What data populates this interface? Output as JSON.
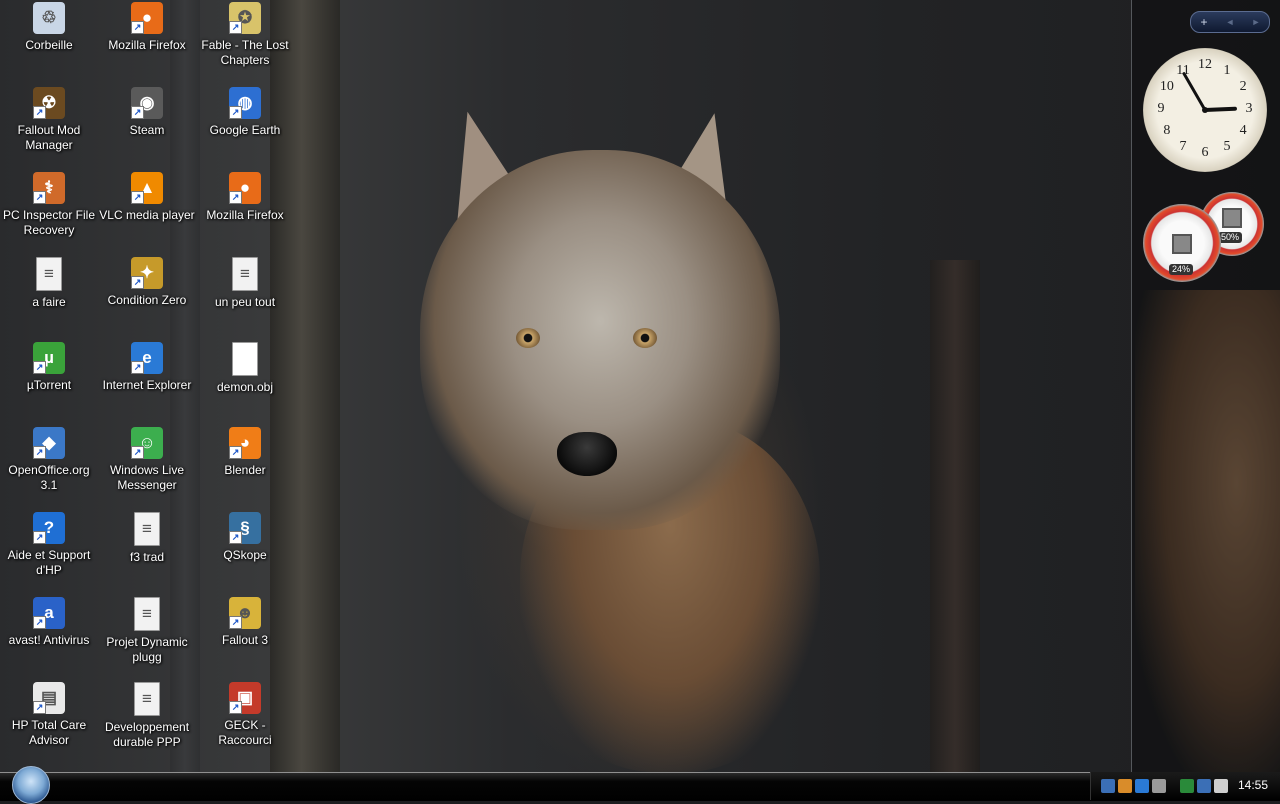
{
  "desktop": {
    "icons": [
      {
        "label": "Corbeille",
        "icon": "recycle-bin-icon",
        "color": "#c9d6e6"
      },
      {
        "label": "Mozilla Firefox",
        "icon": "firefox-icon",
        "color": "#e86b18"
      },
      {
        "label": "Fable - The Lost Chapters",
        "icon": "fable-icon",
        "color": "#d8c36a"
      },
      {
        "label": "Fallout Mod Manager",
        "icon": "fallout-mod-manager-icon",
        "color": "#6b4a20"
      },
      {
        "label": "Steam",
        "icon": "steam-icon",
        "color": "#5a5a5a"
      },
      {
        "label": "Google Earth",
        "icon": "google-earth-icon",
        "color": "#2d6fd2"
      },
      {
        "label": "PC Inspector File Recovery",
        "icon": "pc-inspector-icon",
        "color": "#d06a2a"
      },
      {
        "label": "VLC media player",
        "icon": "vlc-icon",
        "color": "#f08a00"
      },
      {
        "label": "Mozilla Firefox",
        "icon": "firefox-icon",
        "color": "#e86b18"
      },
      {
        "label": "a faire",
        "icon": "text-file-icon",
        "color": "#f2f2f2"
      },
      {
        "label": "Condition Zero",
        "icon": "condition-zero-icon",
        "color": "#c69a2a"
      },
      {
        "label": "un peu tout",
        "icon": "text-file-icon",
        "color": "#f2f2f2"
      },
      {
        "label": "µTorrent",
        "icon": "utorrent-icon",
        "color": "#3aa33a"
      },
      {
        "label": "Internet Explorer",
        "icon": "internet-explorer-icon",
        "color": "#2a7ad6"
      },
      {
        "label": "demon.obj",
        "icon": "blank-file-icon",
        "color": "#ffffff"
      },
      {
        "label": "OpenOffice.org 3.1",
        "icon": "openoffice-icon",
        "color": "#3b78c7"
      },
      {
        "label": "Windows Live Messenger",
        "icon": "messenger-icon",
        "color": "#3cae4e"
      },
      {
        "label": "Blender",
        "icon": "blender-icon",
        "color": "#f07d17"
      },
      {
        "label": "Aide et Support d'HP",
        "icon": "help-support-icon",
        "color": "#1f6fd4"
      },
      {
        "label": "f3 trad",
        "icon": "text-file-icon",
        "color": "#f2f2f2"
      },
      {
        "label": "QSkope",
        "icon": "python-icon",
        "color": "#3670a0"
      },
      {
        "label": "avast! Antivirus",
        "icon": "avast-icon",
        "color": "#2a62c8"
      },
      {
        "label": "Projet Dynamic plugg",
        "icon": "text-file-icon",
        "color": "#f2f2f2"
      },
      {
        "label": "Fallout 3",
        "icon": "fallout3-icon",
        "color": "#d8b33a"
      },
      {
        "label": "HP Total Care Advisor",
        "icon": "hp-total-care-icon",
        "color": "#e9e9e9"
      },
      {
        "label": "Developpement durable PPP",
        "icon": "text-file-icon",
        "color": "#f2f2f2"
      },
      {
        "label": "GECK - Raccourci",
        "icon": "geck-icon",
        "color": "#c43a2a"
      }
    ]
  },
  "sidebar": {
    "add_gadget_label": "+",
    "prev_label": "◄",
    "next_label": "►",
    "clock_numbers": [
      "12",
      "1",
      "2",
      "3",
      "4",
      "5",
      "6",
      "7",
      "8",
      "9",
      "10",
      "11"
    ],
    "clock_time": {
      "hours": 2,
      "minutes": 55
    },
    "meters": {
      "cpu": {
        "value_label": "24%",
        "value": 24
      },
      "memory": {
        "value_label": "50%",
        "value": 50
      }
    }
  },
  "taskbar": {
    "clock": "14:55",
    "tray_icons": [
      "network-icon",
      "people-icon",
      "update-icon",
      "monitor-icon",
      "hp-icon",
      "network-status-icon",
      "volume-icon"
    ]
  }
}
